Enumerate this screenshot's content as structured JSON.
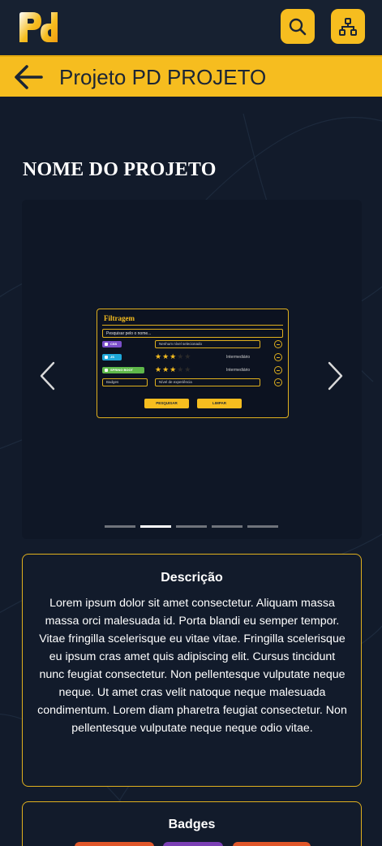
{
  "header": {
    "logo_text": "PD",
    "search_icon": "search-icon",
    "sitemap_icon": "sitemap-icon",
    "accent": "#f6bd1f"
  },
  "title_bar": {
    "back_icon": "arrow-left-icon",
    "title": "Projeto PD PROJETO"
  },
  "project": {
    "name": "NOME DO PROJETO"
  },
  "carousel": {
    "prev_icon": "chevron-left-icon",
    "next_icon": "chevron-right-icon",
    "slide_count": 5,
    "active_index": 1,
    "screenshot": {
      "title": "Filtragem",
      "search_placeholder": "Pesquisar pelo o nome...",
      "rows": [
        {
          "tag": "CSS",
          "tag_color": "#7b4fc9",
          "field": "Nenhum nível selecionado",
          "stars": 0,
          "level": ""
        },
        {
          "tag": "JS",
          "tag_color": "#1ea7d9",
          "field": "",
          "stars": 3,
          "level": "Intermediário"
        },
        {
          "tag": "SPRING BOOT",
          "tag_color": "#5fb84a",
          "field": "",
          "stars": 3,
          "level": "Intermediário"
        }
      ],
      "select_1": "Badges",
      "select_2": "Nível de experiência",
      "search_button": "PESQUISAR",
      "clear_button": "LIMPAR"
    }
  },
  "description": {
    "title": "Descrição",
    "body": "Lorem ipsum dolor sit amet consectetur. Aliquam massa massa orci malesuada id. Porta blandi eu semper tempor. Vitae fringilla scelerisque eu vitae vitae. Fringilla scelerisque eu ipsum cras amet quis adipiscing elit. Cursus tincidunt nunc feugiat consectetur. Non pellentesque vulputate neque neque. Ut amet cras velit natoque neque malesuada condimentum. Lorem diam pharetra feugiat consectetur. Non pellentesque vulputate neque neque odio vitae."
  },
  "badges": {
    "title": "Badges",
    "items": [
      {
        "color": "#e0572a"
      },
      {
        "color": "#7b3fb5"
      },
      {
        "color": "#e0572a"
      }
    ]
  }
}
